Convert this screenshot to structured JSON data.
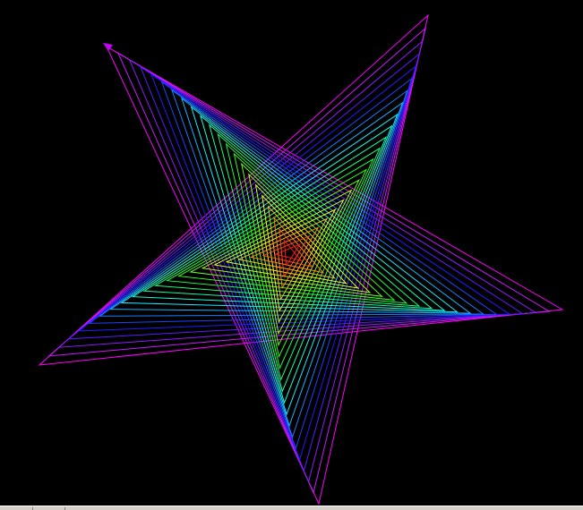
{
  "canvas": {
    "background": "#000000",
    "outer_color": "#ff00ff",
    "inner_color": "#ff0000",
    "nested_outlines": 22,
    "turtle_icon": "triangle-pointer-icon",
    "turtle_color": "#cc00ff"
  },
  "status_bar": {
    "background": "#d4d0c8"
  }
}
